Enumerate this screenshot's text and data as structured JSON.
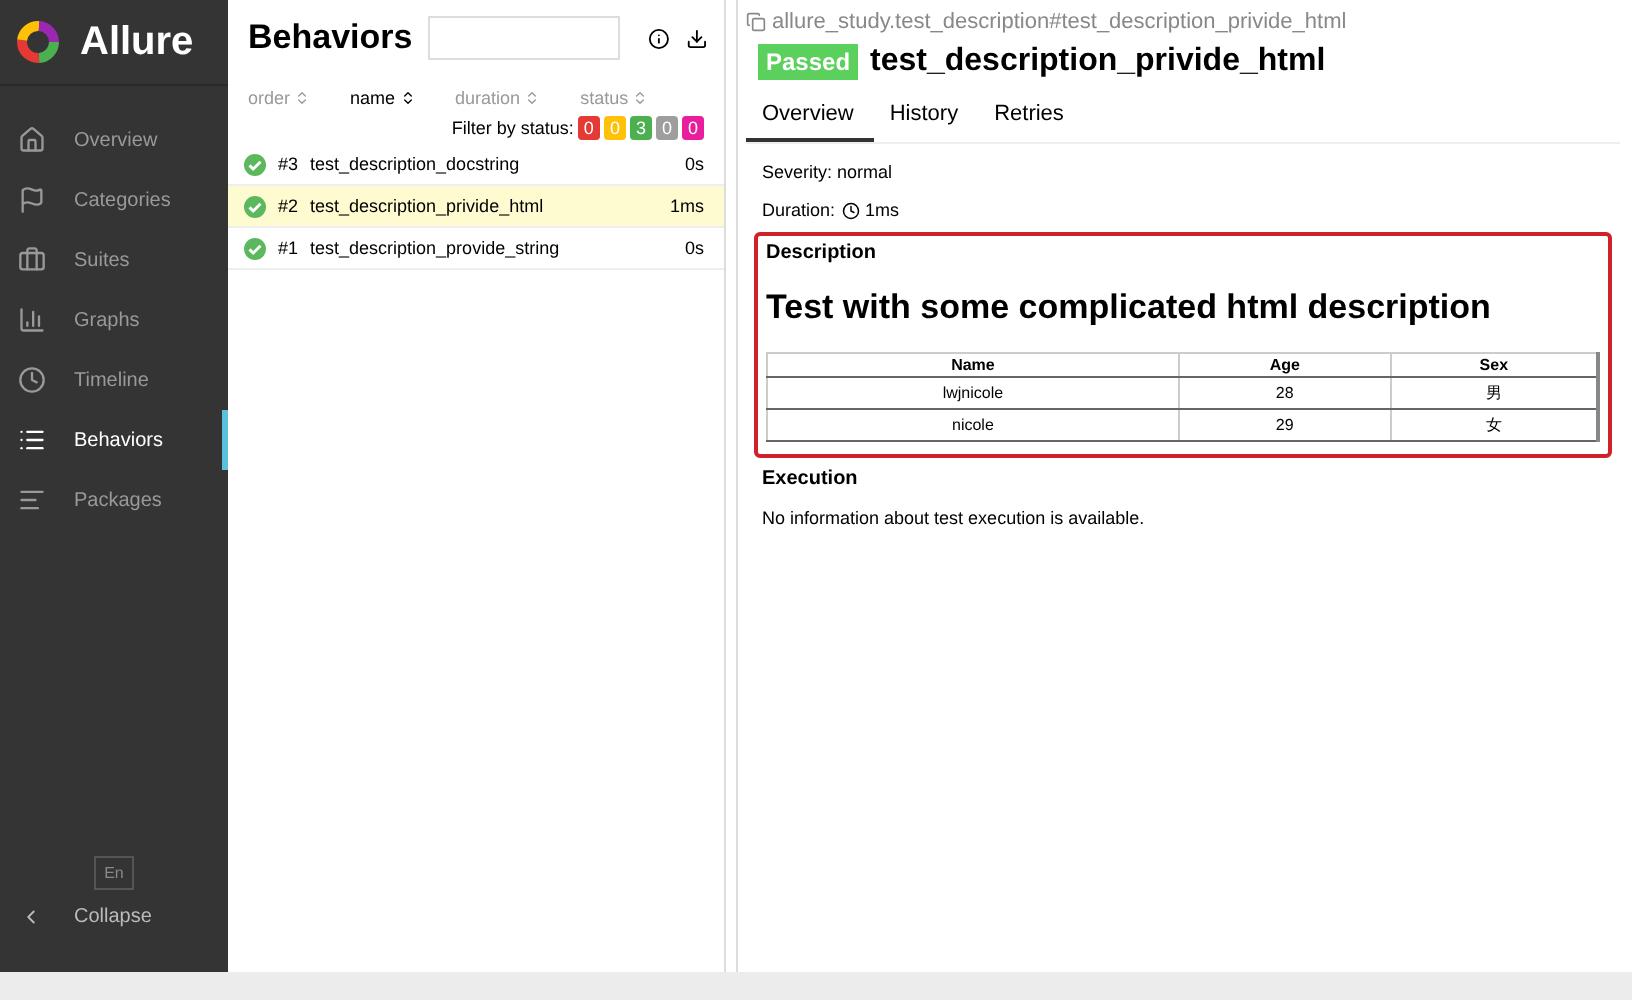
{
  "sidebar": {
    "logo": "Allure",
    "items": [
      {
        "label": "Overview",
        "selected": false
      },
      {
        "label": "Categories",
        "selected": false
      },
      {
        "label": "Suites",
        "selected": false
      },
      {
        "label": "Graphs",
        "selected": false
      },
      {
        "label": "Timeline",
        "selected": false
      },
      {
        "label": "Behaviors",
        "selected": true
      },
      {
        "label": "Packages",
        "selected": false
      }
    ],
    "language": "En",
    "collapse": "Collapse"
  },
  "list": {
    "title": "Behaviors",
    "columns": [
      {
        "label": "order",
        "selected": false
      },
      {
        "label": "name",
        "selected": true
      },
      {
        "label": "duration",
        "selected": false
      },
      {
        "label": "status",
        "selected": false
      }
    ],
    "filter_label": "Filter by status:",
    "filters": [
      {
        "count": "0",
        "color": "#e53935"
      },
      {
        "count": "0",
        "color": "#ffc107"
      },
      {
        "count": "3",
        "color": "#4caf50"
      },
      {
        "count": "0",
        "color": "#9e9e9e"
      },
      {
        "count": "0",
        "color": "#e91e9e"
      }
    ],
    "rows": [
      {
        "order": "#3",
        "name": "test_description_docstring",
        "duration": "0s",
        "selected": false
      },
      {
        "order": "#2",
        "name": "test_description_privide_html",
        "duration": "1ms",
        "selected": true
      },
      {
        "order": "#1",
        "name": "test_description_provide_string",
        "duration": "0s",
        "selected": false
      }
    ]
  },
  "detail": {
    "path": "allure_study.test_description#test_description_privide_html",
    "status": "Passed",
    "title": "test_description_privide_html",
    "tabs": [
      {
        "label": "Overview",
        "selected": true
      },
      {
        "label": "History",
        "selected": false
      },
      {
        "label": "Retries",
        "selected": false
      }
    ],
    "severity": "Severity: normal",
    "duration_label": "Duration:",
    "duration": "1ms",
    "description": {
      "title": "Description",
      "heading": "Test with some complicated html description",
      "table": {
        "columns": [
          "Name",
          "Age",
          "Sex"
        ],
        "rows": [
          [
            "lwjnicole",
            "28",
            "男"
          ],
          [
            "nicole",
            "29",
            "女"
          ]
        ]
      }
    },
    "execution": {
      "title": "Execution",
      "text": "No information about test execution is available."
    }
  }
}
